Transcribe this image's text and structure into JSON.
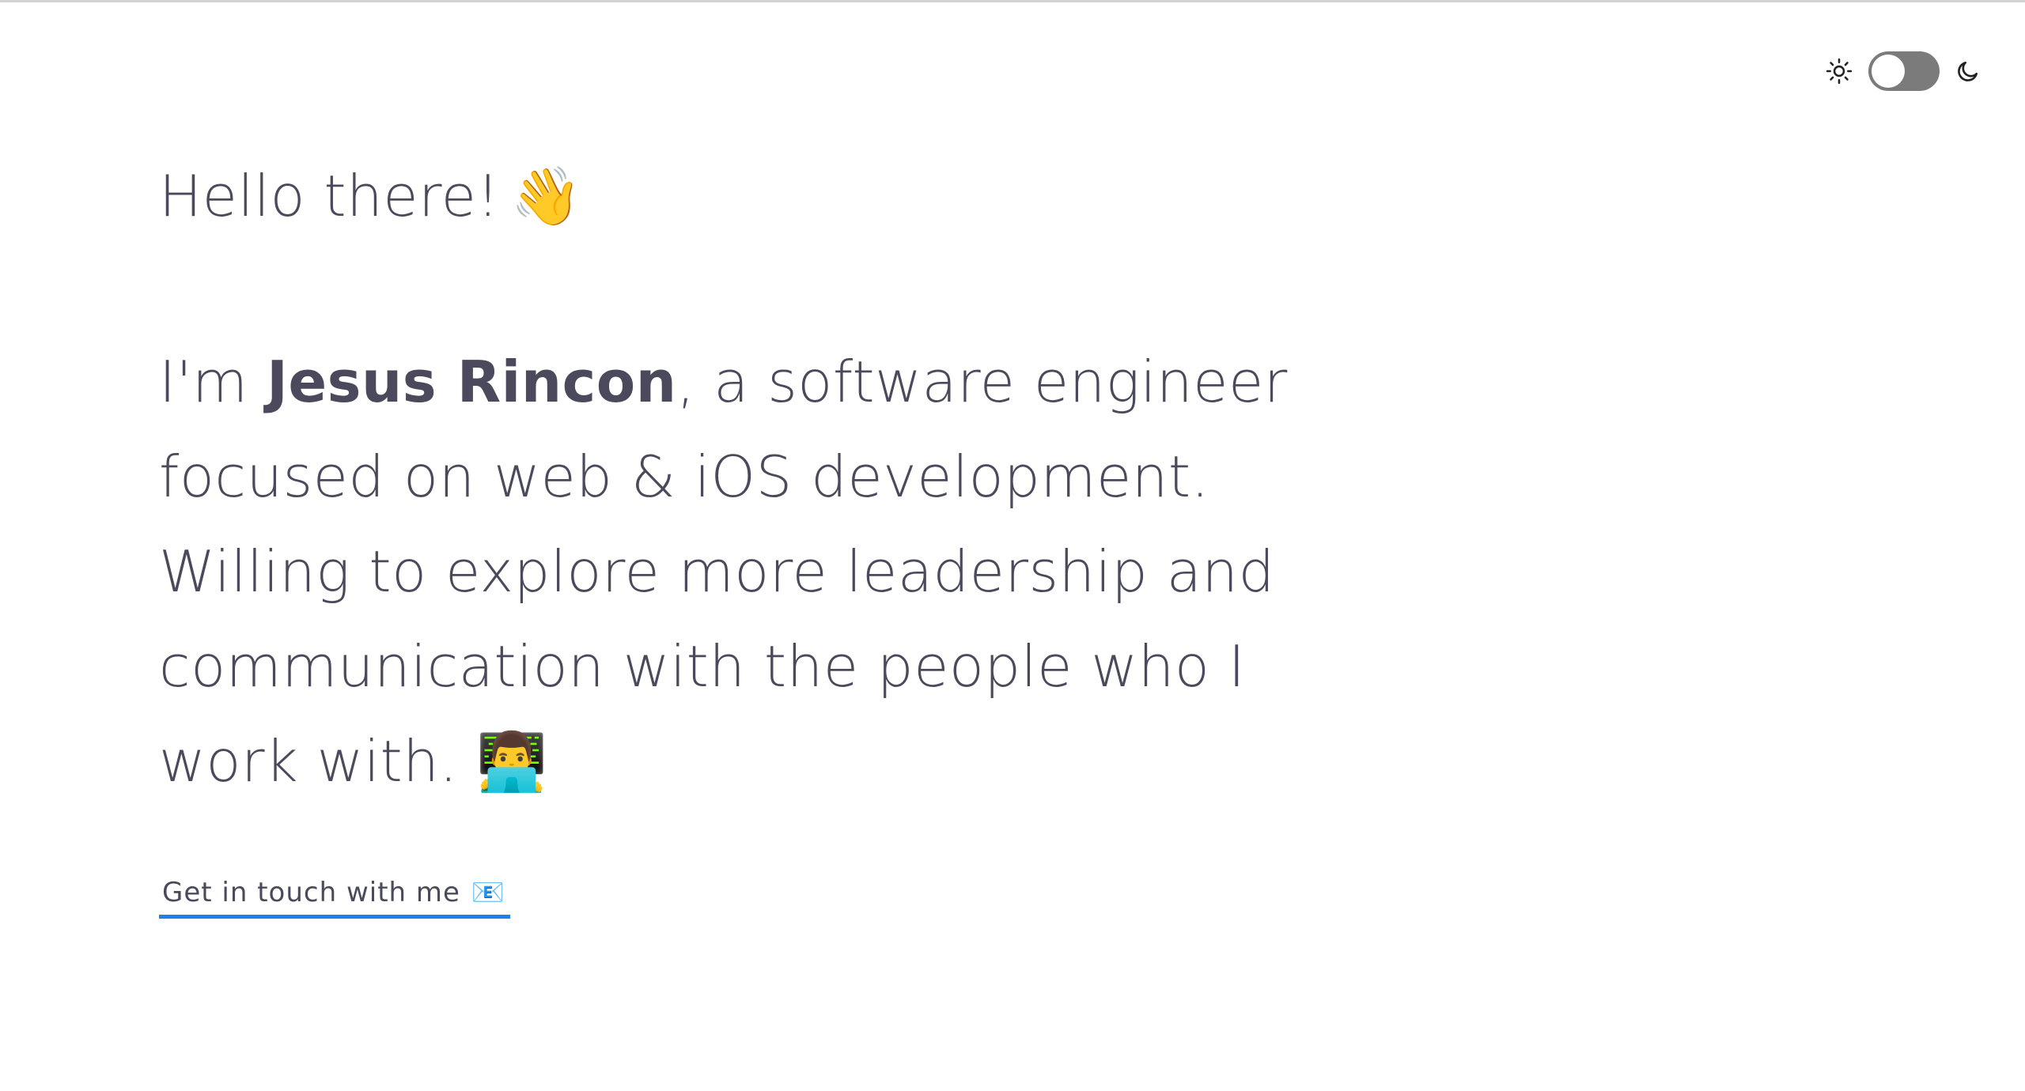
{
  "theme_toggle": {
    "light_icon": "sun-icon",
    "dark_icon": "moon-icon",
    "state": "off",
    "track_color": "#7b7b7b"
  },
  "hero": {
    "greeting": "Hello there!",
    "greeting_emoji": "👋",
    "intro_prefix": "I'm ",
    "name": "Jesus Rincon",
    "intro_rest": ", a software engineer focused on web & iOS development. Willing to explore more leadership and communication with the people who I work with.",
    "intro_emoji": "👨‍💻"
  },
  "contact": {
    "label": "Get in touch with me",
    "emoji": "📧",
    "underline_color": "#1f7ff0"
  }
}
